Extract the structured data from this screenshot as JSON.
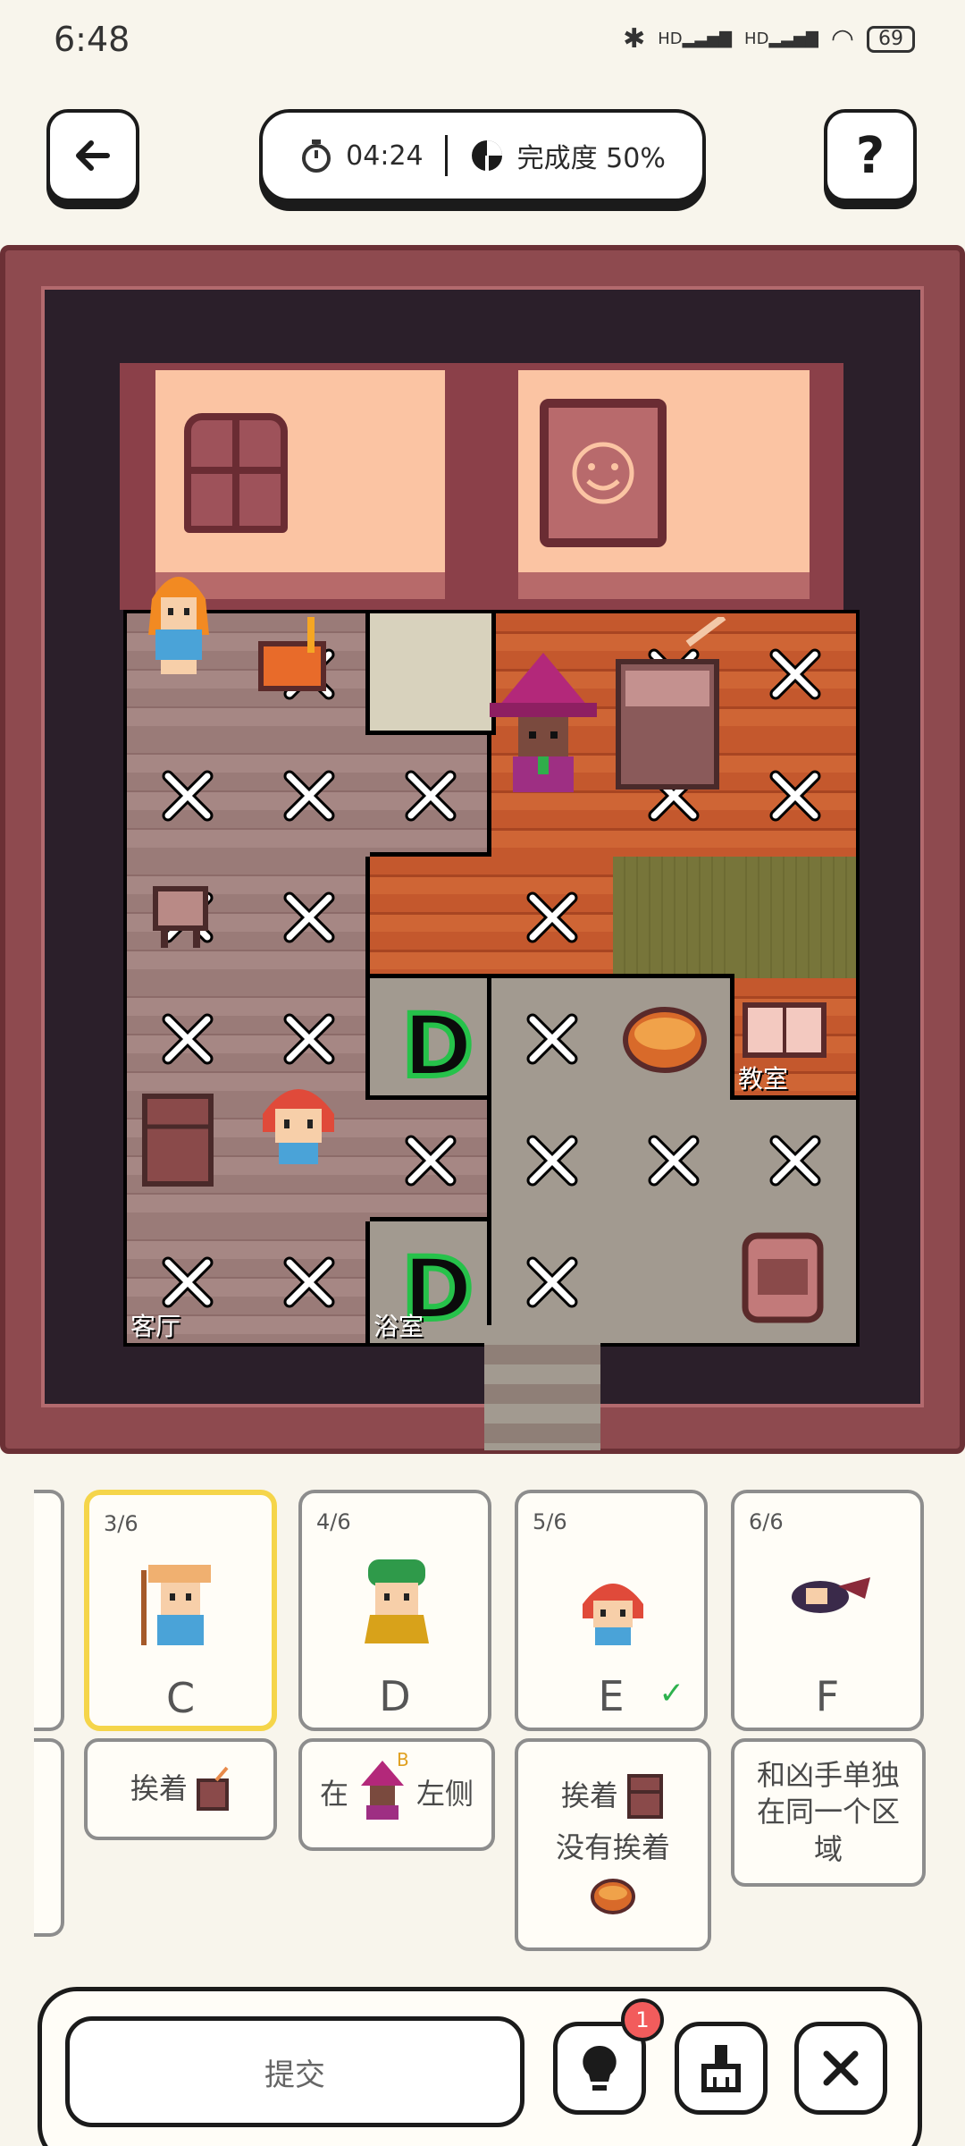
{
  "status_bar": {
    "time": "6:48",
    "signal_label": "HD",
    "battery": "69"
  },
  "header": {
    "timer": "04:24",
    "progress_text": "完成度 50%"
  },
  "board": {
    "room_labels": {
      "classroom": "教室",
      "living_room": "客厅",
      "bathroom": "浴室"
    },
    "door_glyph": "D"
  },
  "cards": [
    {
      "count": "3/6",
      "letter": "C",
      "selected": true
    },
    {
      "count": "4/6",
      "letter": "D",
      "selected": false
    },
    {
      "count": "5/6",
      "letter": "E",
      "selected": false,
      "solved": "✓"
    },
    {
      "count": "6/6",
      "letter": "F",
      "selected": false
    }
  ],
  "clues": {
    "c": "挨着",
    "d_prefix": "在",
    "d_tag": "B",
    "d_suffix": "左侧",
    "e_line1": "挨着",
    "e_line2": "没有挨着",
    "f": "和凶手单独在同一个区域"
  },
  "actions": {
    "submit_label": "提交",
    "hint_badge": "1"
  },
  "colors": {
    "frame": "#8e4a4f",
    "floor_dark": "#2b1f2a",
    "wall_panel": "#fbc4a3",
    "door_green": "#26c24a",
    "selected_card": "#f5d54a",
    "badge_red": "#f25c5c"
  }
}
